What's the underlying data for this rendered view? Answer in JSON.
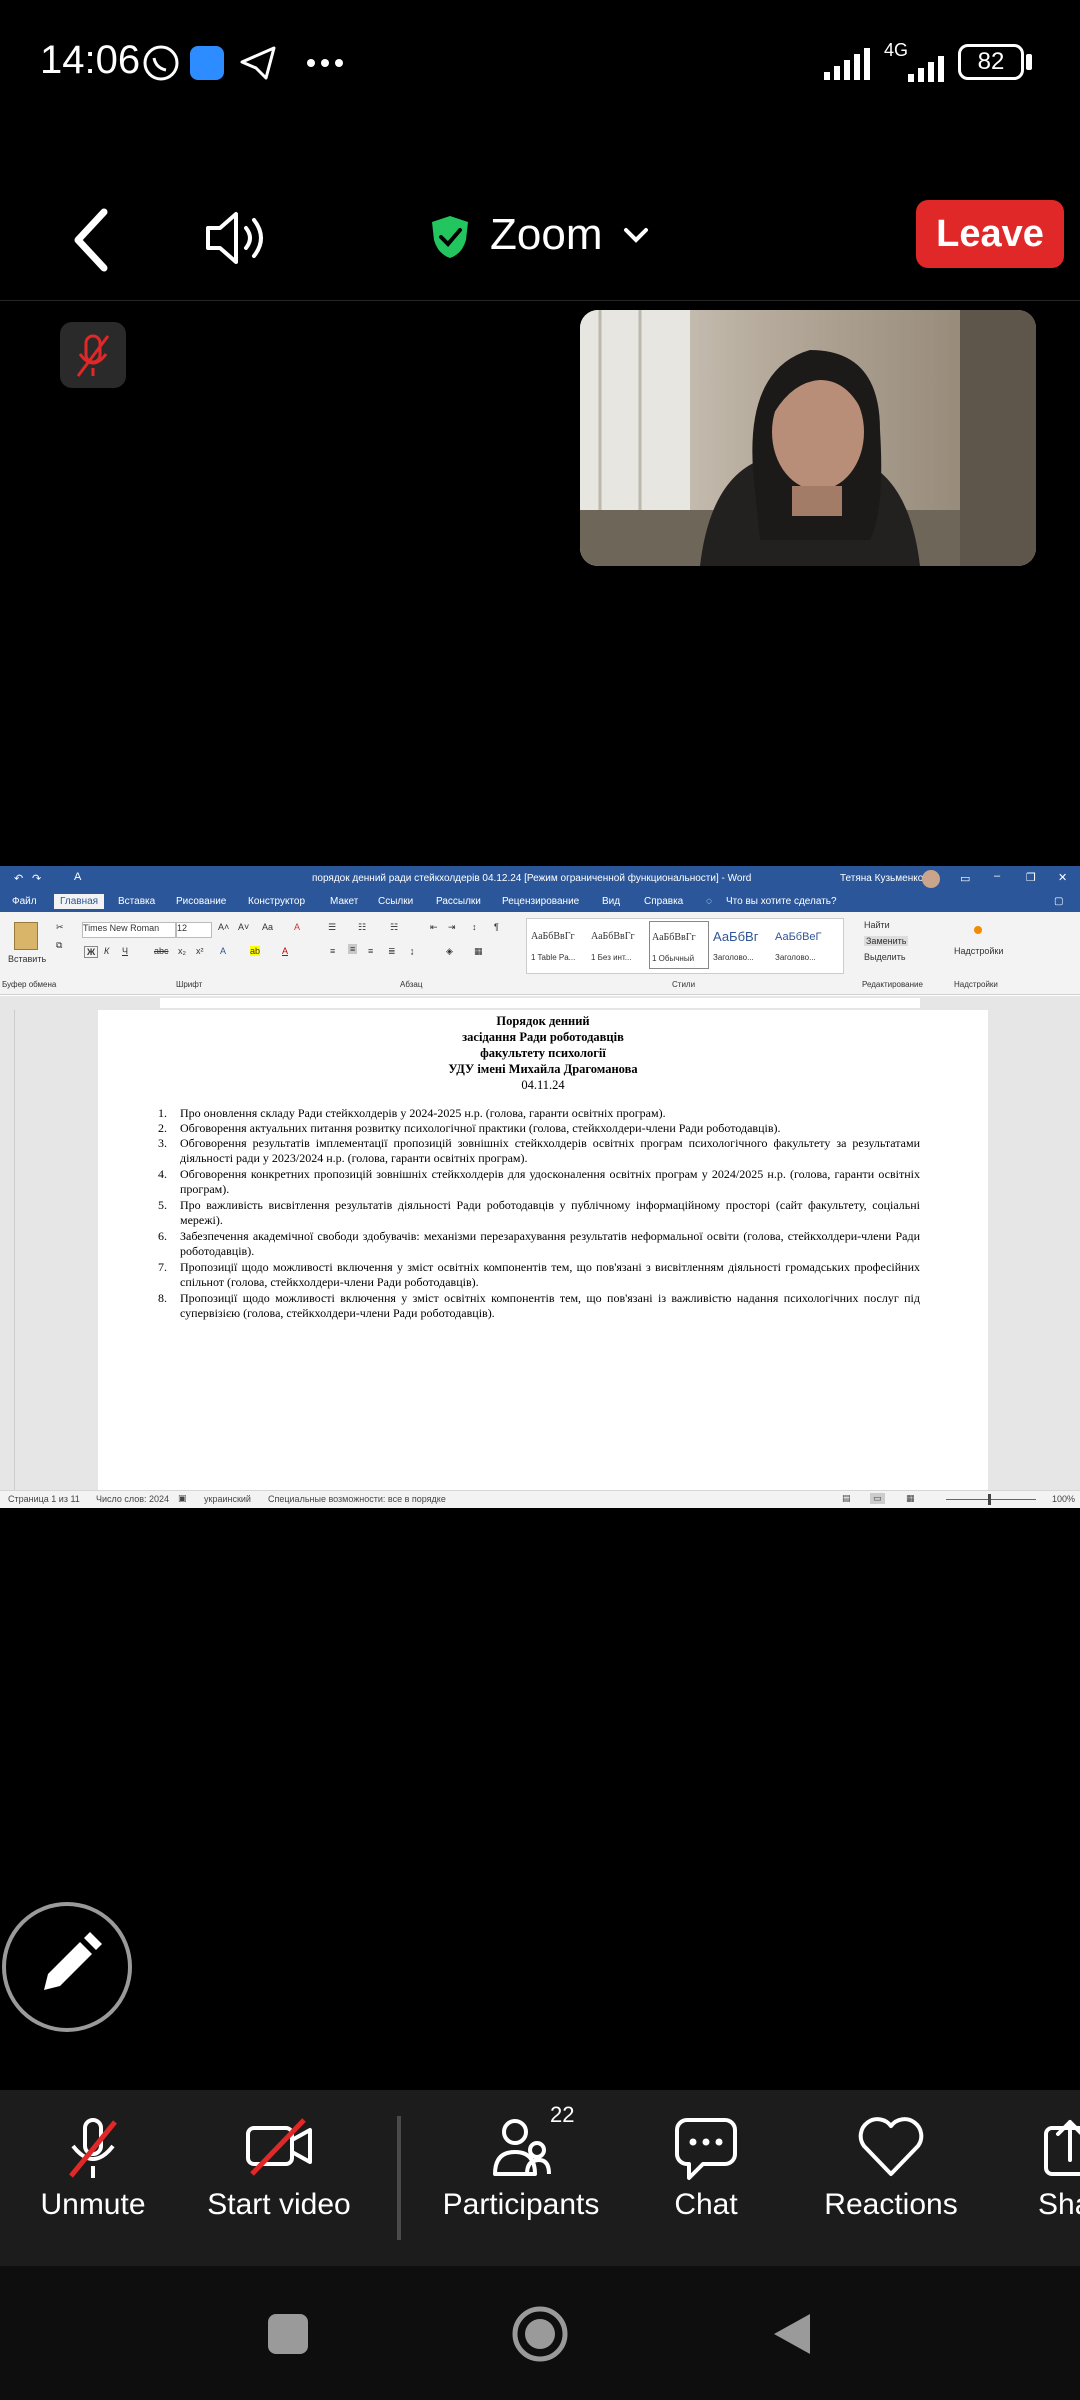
{
  "status_bar": {
    "time": "14:06",
    "battery": "82",
    "network": "4G"
  },
  "top_bar": {
    "title": "Zoom",
    "leave_label": "Leave"
  },
  "word": {
    "window_title": "порядок денний ради стейкхолдерів 04.12.24 [Режим ограниченной функциональности] - Word",
    "user": "Тетяна Кузьменко",
    "menu": [
      "Файл",
      "Главная",
      "Вставка",
      "Рисование",
      "Конструктор",
      "Макет",
      "Ссылки",
      "Рассылки",
      "Рецензирование",
      "Вид",
      "Справка"
    ],
    "tell_me": "Что вы хотите сделать?",
    "font_name": "Times New Roman",
    "font_size": "12",
    "paste_label": "Вставить",
    "group_labels": [
      "Буфер обмена",
      "Шрифт",
      "Абзац",
      "Стили",
      "Редактирование",
      "Надстройки"
    ],
    "styles": [
      {
        "preview": "АаБбВвГг",
        "name": "1 Table Pa..."
      },
      {
        "preview": "АаБбВвГг",
        "name": "1 Без инт..."
      },
      {
        "preview": "АаБбВвГг",
        "name": "1 Обычный"
      },
      {
        "preview": "АаБбВг",
        "name": "Заголово..."
      },
      {
        "preview": "АаБбВеГ",
        "name": "Заголово..."
      }
    ],
    "editing": [
      "Найти",
      "Заменить",
      "Выделить"
    ],
    "addins_label": "Надстройки",
    "status": {
      "page": "Страница 1 из 11",
      "words": "Число слов: 2024",
      "language": "украинский",
      "accessibility": "Специальные возможности: все в порядке",
      "zoom": "100%"
    }
  },
  "document": {
    "headings": [
      "Порядок денний",
      "засідання Ради роботодавців",
      "факультету психології",
      "УДУ імені Михайла Драгоманова",
      "04.11.24"
    ],
    "items": [
      {
        "num": "1.",
        "text": "Про оновлення складу Ради стейкхолдерів у 2024-2025 н.р. (голова, гаранти освітніх програм)."
      },
      {
        "num": "2.",
        "text": "Обговорення актуальних питання розвитку психологічної практики (голова, стейкхолдери-члени Ради роботодавців)."
      },
      {
        "num": "3.",
        "text": "Обговорення результатів імплементації пропозицій зовнішніх стейкхолдерів освітніх програм психологічного факультету за результатами діяльності ради у 2023/2024 н.р. (голова, гаранти освітніх програм)."
      },
      {
        "num": "4.",
        "text": "Обговорення конкретних пропозицій зовнішніх стейкхолдерів для удосконалення освітніх програм у 2024/2025 н.р. (голова, гаранти освітніх програм)."
      },
      {
        "num": "5.",
        "text": "Про важливість висвітлення результатів діяльності Ради роботодавців у публічному інформаційному просторі (сайт факультету, соціальні мережі)."
      },
      {
        "num": "6.",
        "text": "Забезпечення академічної свободи здобувачів: механізми перезарахування результатів неформальної освіти (голова, стейкхолдери-члени Ради роботодавців)."
      },
      {
        "num": "7.",
        "text": "Пропозиції щодо можливості включення у зміст освітніх компонентів тем, що пов'язані з висвітленням діяльності громадських професійних спільнот (голова, стейкхолдери-члени Ради роботодавців)."
      },
      {
        "num": "8.",
        "text": "Пропозиції щодо можливості включення у зміст освітніх компонентів тем, що пов'язані із важливістю надання психологічних послуг під супервізією (голова, стейкхолдери-члени Ради роботодавців)."
      }
    ]
  },
  "toolbar": {
    "unmute": "Unmute",
    "start_video": "Start video",
    "participants": "Participants",
    "participants_count": "22",
    "chat": "Chat",
    "reactions": "Reactions",
    "share": "Share"
  },
  "colors": {
    "leave": "#e02828",
    "word_blue": "#2b579a",
    "shield": "#22c55e",
    "muted_red": "#e02828"
  }
}
